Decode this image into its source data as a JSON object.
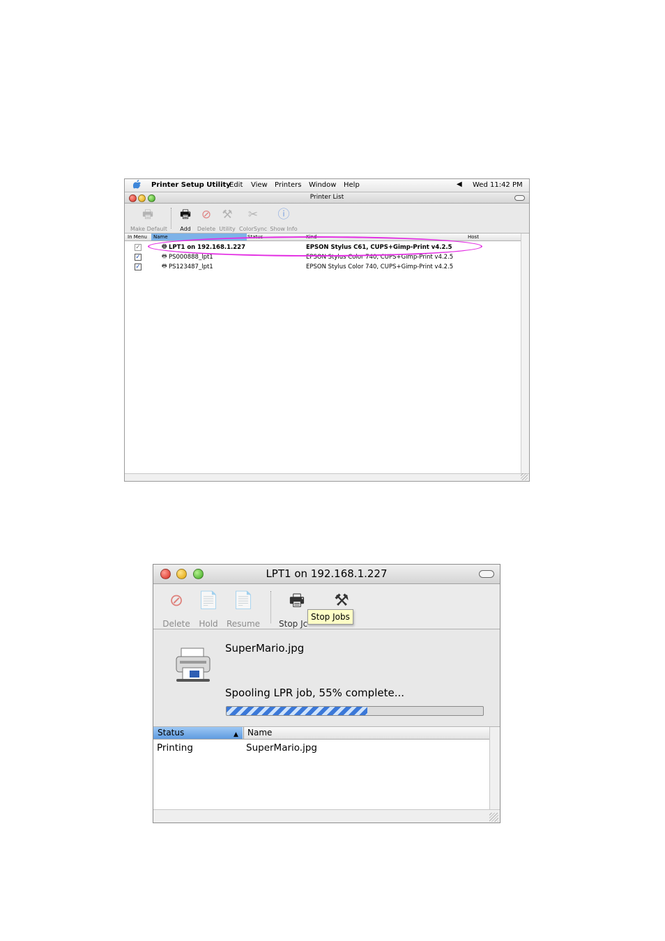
{
  "printer_list_window": {
    "menubar": {
      "app_name": "Printer Setup Utility",
      "menus": [
        "Edit",
        "View",
        "Printers",
        "Window",
        "Help"
      ],
      "clock": "Wed 11:42 PM"
    },
    "title": "Printer List",
    "toolbar": {
      "make_default": "Make Default",
      "add": "Add",
      "delete": "Delete",
      "utility": "Utility",
      "colorsync": "ColorSync",
      "show_info": "Show Info"
    },
    "columns": {
      "in_menu": "In Menu",
      "name": "Name",
      "status": "Status",
      "kind": "Kind",
      "host": "Host"
    },
    "rows": [
      {
        "name": "LPT1 on 192.168.1.227",
        "kind": "EPSON Stylus C61, CUPS+Gimp-Print v4.2.5",
        "in_menu": true,
        "highlighted": true
      },
      {
        "name": "PS000888_lpt1",
        "kind": "EPSON Stylus Color 740, CUPS+Gimp-Print v4.2.5",
        "in_menu": true
      },
      {
        "name": "PS123487_lpt1",
        "kind": "EPSON Stylus Color 740, CUPS+Gimp-Print v4.2.5",
        "in_menu": true
      }
    ],
    "annotation_color": "#e32de3"
  },
  "job_window": {
    "title": "LPT1 on 192.168.1.227",
    "toolbar": {
      "delete": "Delete",
      "hold": "Hold",
      "resume": "Resume",
      "stop_jobs_partial": "Stop Jc",
      "tooltip": "Stop Jobs"
    },
    "current_job": {
      "file": "SuperMario.jpg",
      "status": "Spooling LPR job, 55% complete...",
      "progress": 0.55
    },
    "columns": {
      "status": "Status",
      "name": "Name"
    },
    "rows": [
      {
        "status": "Printing",
        "name": "SuperMario.jpg"
      }
    ],
    "colors": {
      "progress": "#3b78d8",
      "selected_header": "#7db2e8"
    }
  }
}
